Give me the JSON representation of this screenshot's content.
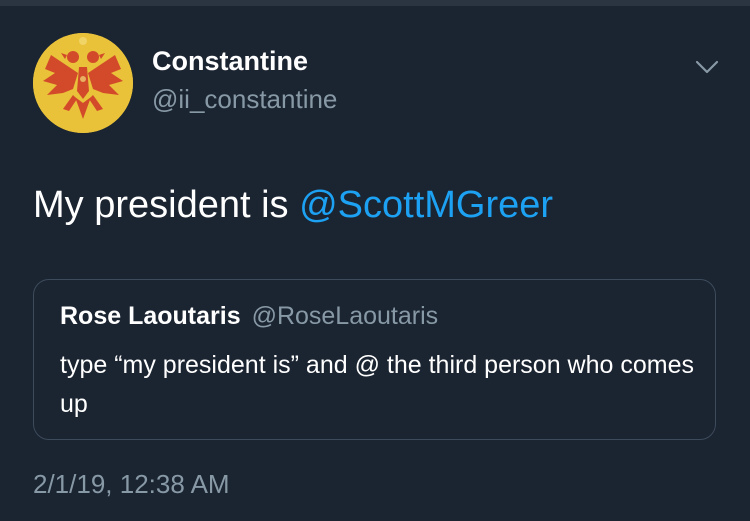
{
  "tweet": {
    "author": {
      "display_name": "Constantine",
      "handle": "@ii_constantine",
      "avatar_icon": "double-headed-eagle-icon"
    },
    "text_prefix": "My president is ",
    "mention": "@ScottMGreer",
    "timestamp": "2/1/19, 12:38 AM",
    "menu_icon": "chevron-down-icon"
  },
  "quoted_tweet": {
    "display_name": "Rose Laoutaris",
    "handle": "@RoseLaoutaris",
    "text": "type “my president is” and @ the third person who comes up"
  },
  "colors": {
    "background": "#1b2431",
    "mention": "#1da1f2",
    "secondary_text": "#8899a6",
    "border": "#3d4b5b",
    "avatar_gold": "#e9c23a",
    "avatar_red": "#d24a2a"
  }
}
